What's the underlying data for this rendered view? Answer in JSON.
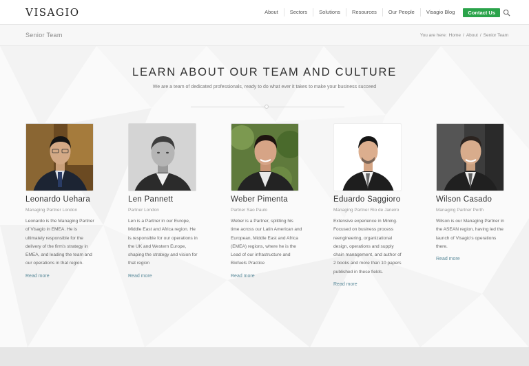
{
  "header": {
    "logo": "VISAGIO",
    "nav": [
      "About",
      "Sectors",
      "Solutions",
      "Resources",
      "Our People",
      "Visagio Blog"
    ],
    "contact_label": "Contact Us"
  },
  "titlebar": {
    "title": "Senior Team",
    "breadcrumb_prefix": "You are here:",
    "crumbs": [
      "Home",
      "/",
      "About",
      "/",
      "Senior Team"
    ]
  },
  "main": {
    "heading": "LEARN ABOUT OUR TEAM AND CULTURE",
    "subheading": "We are a team of dedicated professionals, ready to do what ever it takes to make your business succeed"
  },
  "team": [
    {
      "name": "Leonardo Uehara",
      "role": "Managing Partner London",
      "bio": "Leonardo is the Managing Partner of Visagio in EMEA. He is ultimately responsible for the delivery of the firm's strategy in EMEA, and leading the team and our operations in that region.",
      "read_more": "Read more"
    },
    {
      "name": "Len Pannett",
      "role": "Partner London",
      "bio": "Len is a Partner in our Europe, Middle East and Africa region. He is responsible for our operations in the UK and Western Europe, shaping the strategy and vision for that region",
      "read_more": "Read more"
    },
    {
      "name": "Weber Pimenta",
      "role": "Partner Sao Paulo",
      "bio": "Weber is a Partner, splitting his time across our Latin American and European, Middle East and Africa (EMEA) regions, where he is the Lead of our infrastructure and Biofuels Practice",
      "read_more": "Read more"
    },
    {
      "name": "Eduardo Saggioro",
      "role": "Managing Partner Rio de Janeiro",
      "bio": "Extensive experience in Mining. Focused on business process reengineering, organizational design, operations and supply chain management, and author of 2 books and more than 10 papers published in these fields.",
      "read_more": "Read more"
    },
    {
      "name": "Wilson Casado",
      "role": "Managing Partner Perth",
      "bio": "Wilson is our Managing Partner in the ASEAN region, having led the launch of Visagio's operations there.",
      "read_more": "Read more"
    }
  ]
}
